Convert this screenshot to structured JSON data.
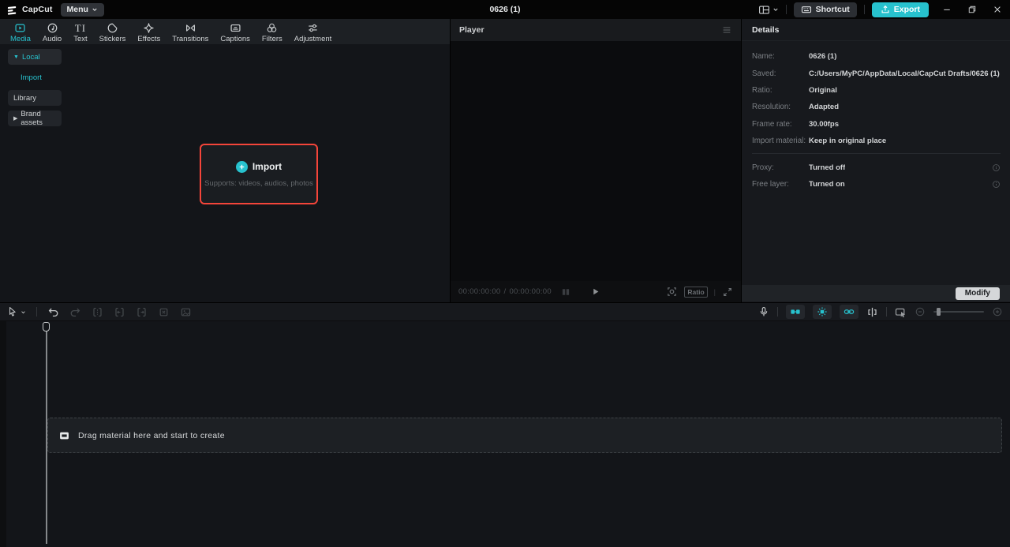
{
  "colors": {
    "accent": "#27c2ce",
    "danger": "#f4453a"
  },
  "topbar": {
    "brand": "CapCut",
    "menu": "Menu",
    "title": "0626 (1)",
    "shortcut": "Shortcut",
    "export": "Export"
  },
  "media_panel": {
    "tabs": [
      {
        "label": "Media"
      },
      {
        "label": "Audio"
      },
      {
        "label": "Text"
      },
      {
        "label": "Stickers"
      },
      {
        "label": "Effects"
      },
      {
        "label": "Transitions"
      },
      {
        "label": "Captions"
      },
      {
        "label": "Filters"
      },
      {
        "label": "Adjustment"
      }
    ],
    "active_tab": "Media",
    "sidebar": {
      "local": "Local",
      "import": "Import",
      "library": "Library",
      "brand_assets": "Brand assets"
    },
    "import_box": {
      "button": "Import",
      "hint": "Supports: videos, audios, photos"
    }
  },
  "player": {
    "title": "Player",
    "current_time": "00:00:00:00",
    "separator": "/",
    "total_time": "00:00:00:00",
    "ratio": "Ratio"
  },
  "details": {
    "title": "Details",
    "rows": [
      {
        "label": "Name:",
        "value": "0626 (1)"
      },
      {
        "label": "Saved:",
        "value": "C:/Users/MyPC/AppData/Local/CapCut Drafts/0626 (1)"
      },
      {
        "label": "Ratio:",
        "value": "Original"
      },
      {
        "label": "Resolution:",
        "value": "Adapted"
      },
      {
        "label": "Frame rate:",
        "value": "30.00fps"
      },
      {
        "label": "Import material:",
        "value": "Keep in original place"
      }
    ],
    "toggle_rows": [
      {
        "label": "Proxy:",
        "value": "Turned off"
      },
      {
        "label": "Free layer:",
        "value": "Turned on"
      }
    ],
    "modify": "Modify"
  },
  "timeline": {
    "empty_hint": "Drag material here and start to create"
  }
}
